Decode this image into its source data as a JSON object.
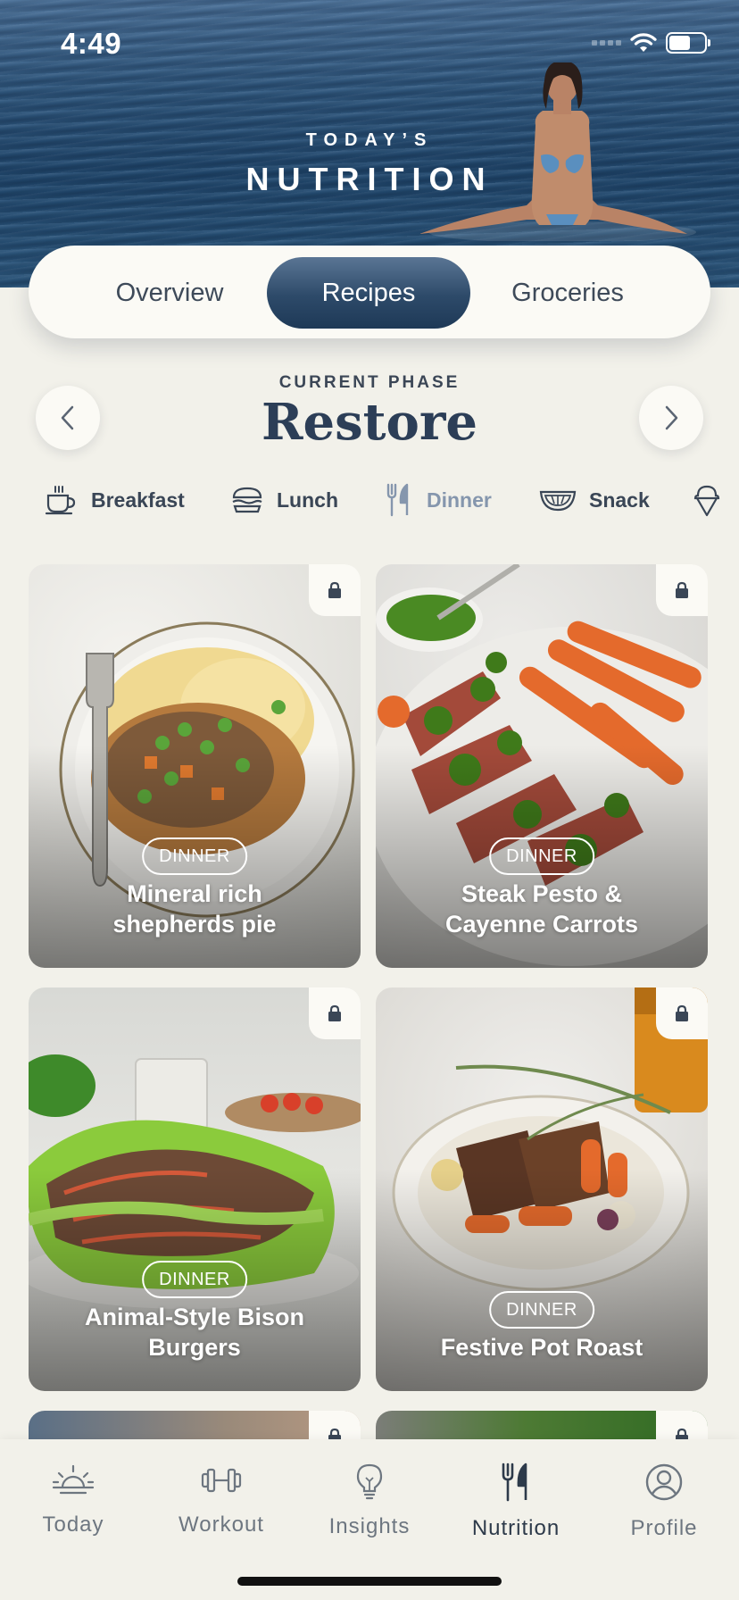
{
  "status_bar": {
    "time": "4:49"
  },
  "hero": {
    "subtitle": "TODAY’S",
    "title": "NUTRITION"
  },
  "segments": [
    {
      "label": "Overview",
      "active": false
    },
    {
      "label": "Recipes",
      "active": true
    },
    {
      "label": "Groceries",
      "active": false
    }
  ],
  "phase": {
    "label": "CURRENT PHASE",
    "name": "Restore"
  },
  "meal_categories": [
    {
      "label": "Breakfast",
      "icon": "coffee-cup-icon",
      "active": false
    },
    {
      "label": "Lunch",
      "icon": "burger-icon",
      "active": false
    },
    {
      "label": "Dinner",
      "icon": "fork-knife-icon",
      "active": true
    },
    {
      "label": "Snack",
      "icon": "melon-slice-icon",
      "active": false
    },
    {
      "label": "",
      "icon": "ice-cream-icon",
      "active": false
    }
  ],
  "recipes": [
    {
      "tag": "DINNER",
      "title_line1": "Mineral rich",
      "title_line2": "shepherds pie",
      "locked": true
    },
    {
      "tag": "DINNER",
      "title_line1": "Steak Pesto &",
      "title_line2": "Cayenne Carrots",
      "locked": true
    },
    {
      "tag": "DINNER",
      "title_line1": "Animal-Style Bison",
      "title_line2": "Burgers",
      "locked": true
    },
    {
      "tag": "DINNER",
      "title_line1": "Festive Pot Roast",
      "title_line2": "",
      "locked": true
    }
  ],
  "tabs": [
    {
      "label": "Today",
      "icon": "sunrise-icon",
      "active": false
    },
    {
      "label": "Workout",
      "icon": "dumbbell-icon",
      "active": false
    },
    {
      "label": "Insights",
      "icon": "lightbulb-icon",
      "active": false
    },
    {
      "label": "Nutrition",
      "icon": "fork-knife-icon",
      "active": true
    },
    {
      "label": "Profile",
      "icon": "profile-icon",
      "active": false
    }
  ],
  "colors": {
    "accent": "#2d4a69",
    "background": "#f2f1ea",
    "inactive_category": "#8596ad"
  }
}
